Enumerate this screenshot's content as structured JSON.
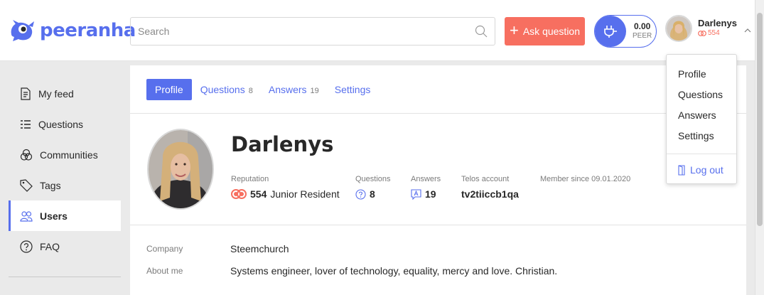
{
  "header": {
    "logo_text": "peeranha",
    "search_placeholder": "Search",
    "ask_button_label": "Ask question",
    "wallet_amount": "0.00",
    "wallet_unit": "PEER",
    "user_name": "Darlenys",
    "user_reputation": "554"
  },
  "sidebar": {
    "items": [
      {
        "label": "My feed",
        "icon": "document-icon"
      },
      {
        "label": "Questions",
        "icon": "list-icon"
      },
      {
        "label": "Communities",
        "icon": "circles-icon"
      },
      {
        "label": "Tags",
        "icon": "tag-icon"
      },
      {
        "label": "Users",
        "icon": "users-icon",
        "active": true
      },
      {
        "label": "FAQ",
        "icon": "question-icon"
      }
    ]
  },
  "tabs": {
    "profile": "Profile",
    "questions": "Questions",
    "questions_count": "8",
    "answers": "Answers",
    "answers_count": "19",
    "settings": "Settings"
  },
  "profile": {
    "name": "Darlenys",
    "reputation_label": "Reputation",
    "reputation_value": "554",
    "reputation_rank": "Junior Resident",
    "questions_label": "Questions",
    "questions_value": "8",
    "answers_label": "Answers",
    "answers_value": "19",
    "telos_label": "Telos account",
    "telos_value": "tv2tiiccb1qa",
    "member_since": "Member since 09.01.2020",
    "company_label": "Company",
    "company_value": "Steemchurch",
    "about_label": "About me",
    "about_value": "Systems engineer, lover of technology, equality, mercy and love. Christian."
  },
  "dropdown": {
    "profile": "Profile",
    "questions": "Questions",
    "answers": "Answers",
    "settings": "Settings",
    "logout": "Log out"
  },
  "colors": {
    "accent": "#576fed",
    "ask_button": "#f76f60",
    "reputation": "#f76f60"
  }
}
